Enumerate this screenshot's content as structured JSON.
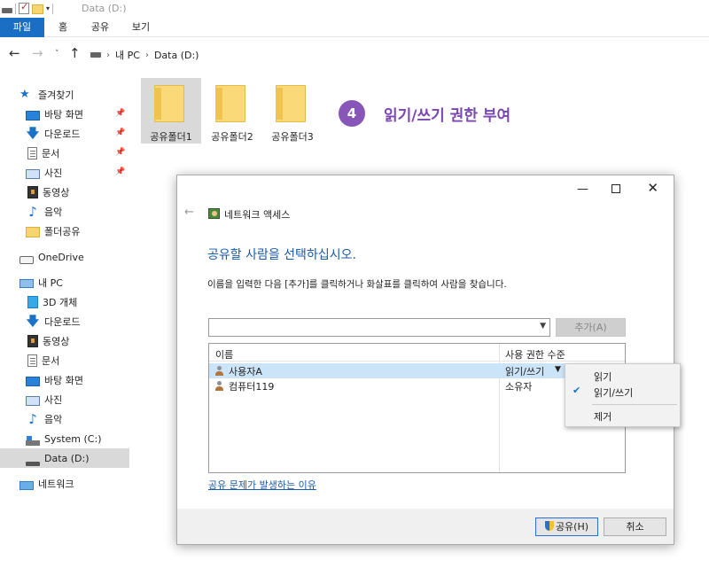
{
  "window": {
    "title": "Data (D:)"
  },
  "ribbon": {
    "tabs": [
      "파일",
      "홈",
      "공유",
      "보기"
    ]
  },
  "address": {
    "crumbs": [
      "내 PC",
      "Data (D:)"
    ]
  },
  "sidebar": {
    "favorites_label": "즐겨찾기",
    "favorites": [
      "바탕 화면",
      "다운로드",
      "문서",
      "사진",
      "동영상",
      "음악",
      "폴더공유"
    ],
    "onedrive_label": "OneDrive",
    "pc_label": "내 PC",
    "pc_items": [
      "3D 개체",
      "다운로드",
      "동영상",
      "문서",
      "바탕 화면",
      "사진",
      "음악",
      "System (C:)",
      "Data (D:)"
    ],
    "network_label": "네트워크"
  },
  "folders": [
    "공유폴더1",
    "공유폴더2",
    "공유폴더3"
  ],
  "annotation": {
    "step_number": "4",
    "step_text": "읽기/쓰기 권한 부여",
    "color": "#7a46b0"
  },
  "dialog": {
    "title": "네트워크 액세스",
    "heading": "공유할 사람을 선택하십시오.",
    "instruction": "이름을 입력한 다음 [추가]를 클릭하거나 화살표를 클릭하여 사람을 찾습니다.",
    "add_button": "추가(A)",
    "columns": {
      "name": "이름",
      "permission": "사용 권한 수준"
    },
    "users": [
      {
        "name": "사용자A",
        "permission": "읽기/쓰기"
      },
      {
        "name": "컴퓨터119",
        "permission": "소유자"
      }
    ],
    "help_link": "공유 문제가 발생하는 이유",
    "share_button": "공유(H)",
    "cancel_button": "취소"
  },
  "permission_menu": {
    "items": [
      "읽기",
      "읽기/쓰기",
      "제거"
    ],
    "checked_index": 1
  },
  "colors": {
    "accent": "#1a6fc4",
    "link": "#1a5aa8",
    "selection": "#cce4f7"
  }
}
